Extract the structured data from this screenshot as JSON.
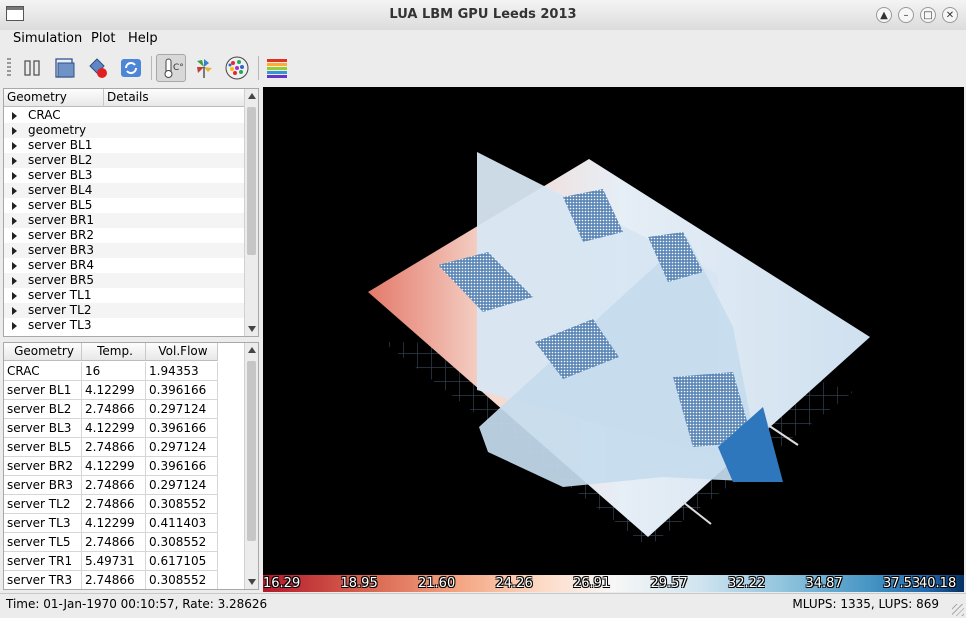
{
  "window": {
    "title": "LUA LBM GPU Leeds 2013"
  },
  "menu": {
    "simulation": "Simulation",
    "plot": "Plot",
    "help": "Help"
  },
  "toolbar": [
    "pause-icon",
    "open-file-icon",
    "record-icon",
    "refresh-icon",
    "temperature-icon",
    "fan-icon",
    "particles-icon",
    "colormap-icon"
  ],
  "tree": {
    "headers": [
      "Geometry",
      "Details"
    ],
    "items": [
      "CRAC",
      "geometry",
      "server BL1",
      "server BL2",
      "server BL3",
      "server BL4",
      "server BL5",
      "server BR1",
      "server BR2",
      "server BR3",
      "server BR4",
      "server BR5",
      "server TL1",
      "server TL2",
      "server TL3"
    ]
  },
  "table": {
    "headers": [
      "Geometry",
      "Temp.",
      "Vol.Flow"
    ],
    "rows": [
      [
        "CRAC",
        "16",
        "1.94353"
      ],
      [
        "server BL1",
        "4.12299",
        "0.396166"
      ],
      [
        "server BL2",
        "2.74866",
        "0.297124"
      ],
      [
        "server BL3",
        "4.12299",
        "0.396166"
      ],
      [
        "server BL5",
        "2.74866",
        "0.297124"
      ],
      [
        "server BR2",
        "4.12299",
        "0.396166"
      ],
      [
        "server BR3",
        "2.74866",
        "0.297124"
      ],
      [
        "server TL2",
        "2.74866",
        "0.308552"
      ],
      [
        "server TL3",
        "4.12299",
        "0.411403"
      ],
      [
        "server TL5",
        "2.74866",
        "0.308552"
      ],
      [
        "server TR1",
        "5.49731",
        "0.617105"
      ],
      [
        "server TR3",
        "2.74866",
        "0.308552"
      ]
    ]
  },
  "colorbar": {
    "labels": [
      "16.29",
      "18.95",
      "21.60",
      "24.26",
      "26.91",
      "29.57",
      "32.22",
      "34.87",
      "37.53",
      "40.18"
    ]
  },
  "status": {
    "left": "Time: 01-Jan-1970 00:10:57, Rate: 3.28626",
    "right": "MLUPS: 1335, LUPS: 869"
  }
}
